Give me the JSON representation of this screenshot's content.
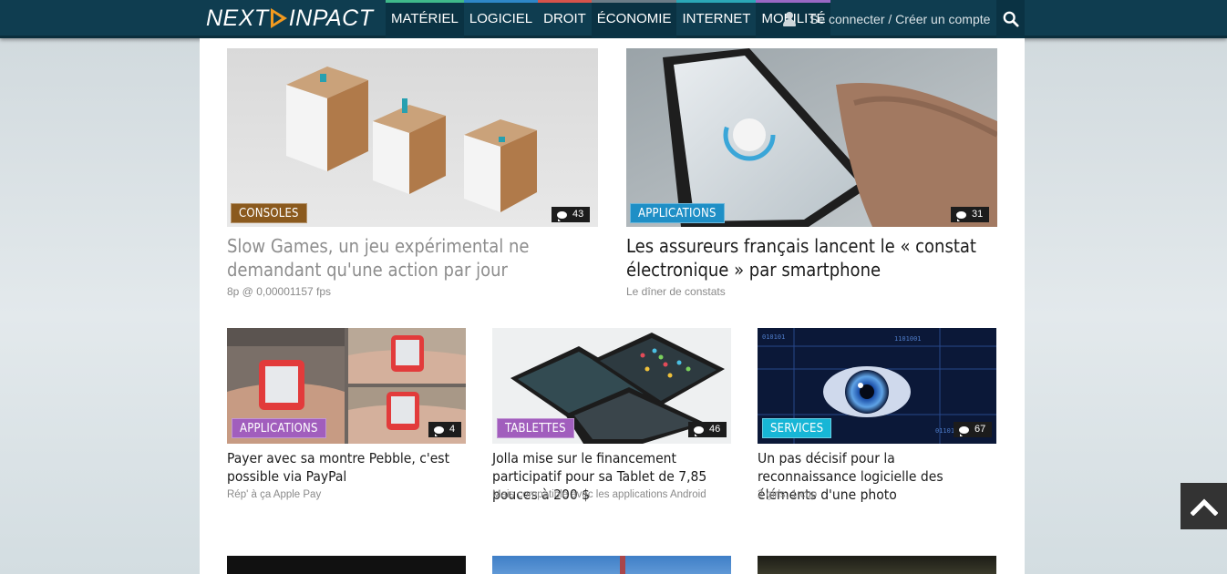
{
  "header": {
    "logo": "NEXTINPACT",
    "logo_left": "NEXT",
    "logo_right": "INPACT",
    "nav": [
      {
        "label": "MATÉRIEL",
        "color": "#3fb98a"
      },
      {
        "label": "LOGICIEL",
        "color": "#2e87c8"
      },
      {
        "label": "DROIT",
        "color": "#d6534b"
      },
      {
        "label": "ÉCONOMIE",
        "color": "#6b7c87"
      },
      {
        "label": "INTERNET",
        "color": "#2ba8b7"
      },
      {
        "label": "MOBILITÉ",
        "color": "#9a68c4"
      }
    ],
    "user_icon": "user-icon",
    "login_text": "Se connecter / Créer un compte",
    "search_icon": "search-icon"
  },
  "featured": [
    {
      "category": "CONSOLES",
      "category_color": "#8b5a1e",
      "comments": "43",
      "title": "Slow Games, un jeu expérimental ne demandant qu'une action par jour",
      "subtitle": "8p @ 0,00001157 fps",
      "visited": true
    },
    {
      "category": "APPLICATIONS",
      "category_color": "#1f8fc6",
      "comments": "31",
      "title": "Les assureurs français lancent le « constat électronique » par smartphone",
      "subtitle": "Le dîner de constats",
      "visited": false
    }
  ],
  "articles": [
    {
      "category": "APPLICATIONS",
      "category_color": "#a15ebd",
      "comments": "4",
      "title": "Payer avec sa montre Pebble, c'est possible via PayPal",
      "subtitle": "Rép' à ça Apple Pay"
    },
    {
      "category": "TABLETTES",
      "category_color": "#a15ebd",
      "comments": "46",
      "title": "Jolla mise sur le financement participatif pour sa Tablet de 7,85 pouces à 200 $",
      "subtitle": "Mais compatible avec les applications Android"
    },
    {
      "category": "SERVICES",
      "category_color": "#17b6d6",
      "comments": "67",
      "title": "Un pas décisif pour la reconnaissance logicielle des éléments d'une photo",
      "subtitle": "2 girls, 1 cup"
    }
  ],
  "back_to_top_icon": "chevron-up-icon"
}
